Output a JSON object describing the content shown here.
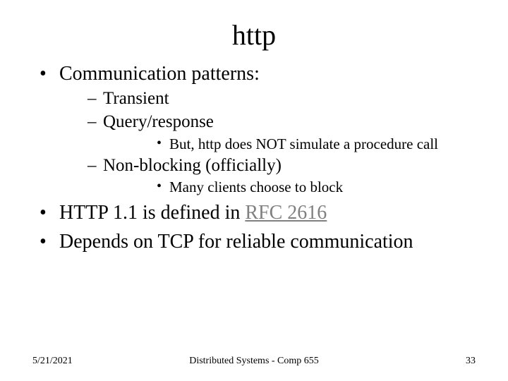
{
  "title": "http",
  "bullets": {
    "b1": "Communication patterns:",
    "b1a": "Transient",
    "b1b": "Query/response",
    "b1b_i": "But, http does NOT simulate a procedure call",
    "b1c": "Non-blocking (officially)",
    "b1c_i": "Many clients choose to block",
    "b2_pre": "HTTP 1.1 is defined in ",
    "b2_link": "RFC 2616",
    "b3": "Depends on TCP for reliable communication"
  },
  "footer": {
    "date": "5/21/2021",
    "course": "Distributed Systems - Comp 655",
    "page": "33"
  }
}
